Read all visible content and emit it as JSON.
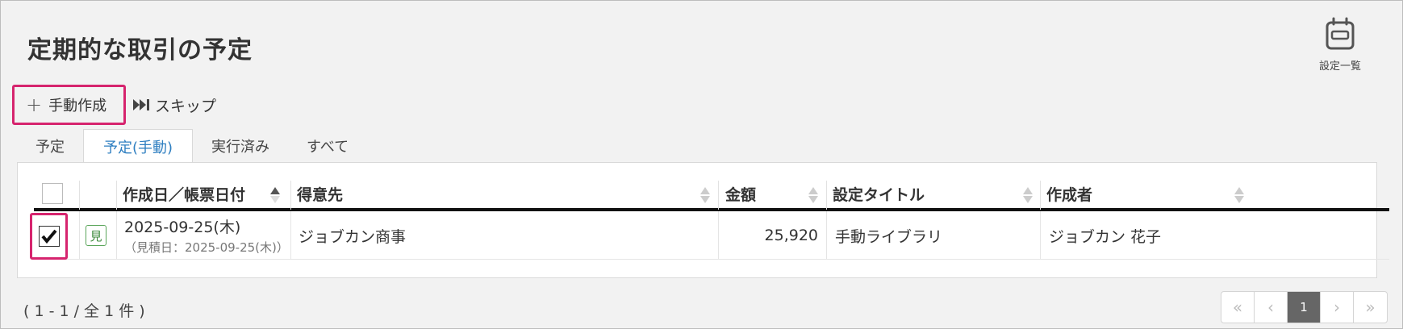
{
  "page": {
    "title": "定期的な取引の予定"
  },
  "settings": {
    "label": "設定一覧",
    "icon": "calendar-icon"
  },
  "toolbar": {
    "manual_create_label": "手動作成",
    "manual_create_icon": "plus-icon",
    "skip_label": "スキップ",
    "skip_icon": "skip-forward-icon"
  },
  "tabs": [
    {
      "label": "予定",
      "active": false
    },
    {
      "label": "予定(手動)",
      "active": true
    },
    {
      "label": "実行済み",
      "active": false
    },
    {
      "label": "すべて",
      "active": false
    }
  ],
  "table": {
    "columns": [
      {
        "label": "",
        "key": "select"
      },
      {
        "label": "",
        "key": "badge"
      },
      {
        "label": "作成日／帳票日付",
        "sort": "asc"
      },
      {
        "label": "得意先",
        "sort": "none"
      },
      {
        "label": "金額",
        "sort": "none"
      },
      {
        "label": "設定タイトル",
        "sort": "none"
      },
      {
        "label": "作成者",
        "sort": "none"
      }
    ],
    "rows": [
      {
        "checked": true,
        "badge": "見",
        "date": "2025-09-25(木)",
        "date_sub": "（見積日：2025-09-25(木)）",
        "customer": "ジョブカン商事",
        "amount": "25,920",
        "setting_title": "手動ライブラリ",
        "creator": "ジョブカン 花子"
      }
    ]
  },
  "footer": {
    "count": "( 1 - 1 / 全 1 件 )",
    "pager": {
      "first": "«",
      "prev": "‹",
      "current": "1",
      "next": "›",
      "last": "»"
    }
  },
  "colors": {
    "accent": "#2f7fc1",
    "highlight": "#d6246e",
    "badge": "#5aa55a"
  }
}
